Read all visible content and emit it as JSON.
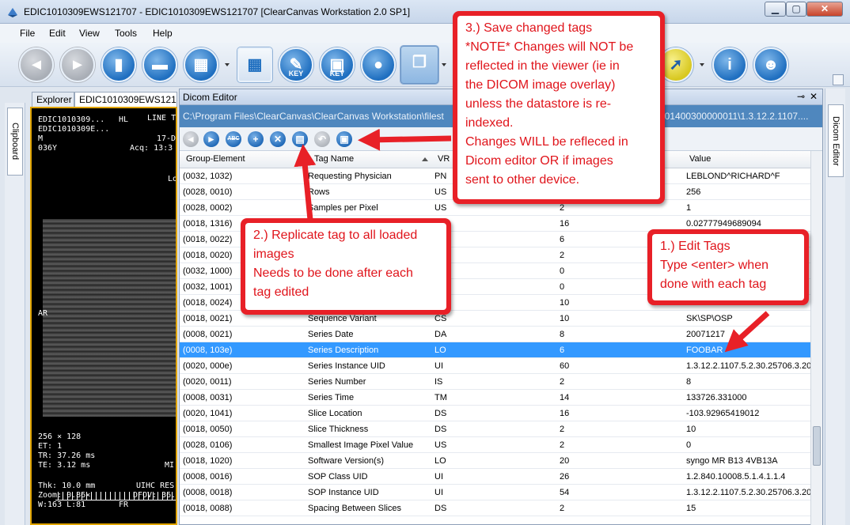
{
  "window": {
    "title": "EDIC1010309EWS121707 - EDIC1010309EWS121707 [ClearCanvas Workstation 2.0 SP1]",
    "min": "▁",
    "max": "▢",
    "close": "✕"
  },
  "menu": [
    "File",
    "Edit",
    "View",
    "Tools",
    "Help"
  ],
  "toolbar": {
    "key_label_1": "KEY",
    "key_label_2": "KEY"
  },
  "clipboard_tab": "Clipboard",
  "tabs": {
    "explorer": "Explorer",
    "study": "EDIC1010309EWS121"
  },
  "viewer": {
    "top_left_1": "EDIC1010309...",
    "top_left_2": "EDIC1010309E...",
    "top_left_3": "M",
    "top_left_4": "036Y",
    "top_mid": "HL",
    "top_right_1": "LINE TA",
    "top_right_2": "17-D",
    "top_right_3": "Acq: 13:3",
    "side_lo": "Lo",
    "orient": "AR",
    "bl_1": "256 × 128",
    "bl_2": "ET: 1",
    "bl_3": "TR: 37.26 ms",
    "bl_4": "TE: 3.12 ms",
    "br_mi": "MI",
    "bl_5": "Thk: 10.0 mm",
    "bl_6": "Zoom: 0.86×",
    "bl_7": "W:163 L:81",
    "br_1": "UIHC RES",
    "br_2": "DFOV: 36.",
    "br_3": "FR"
  },
  "editor": {
    "title": "Dicom Editor",
    "pin": "⊸",
    "close": "✕",
    "path_left": "C:\\Program  Files\\ClearCanvas\\ClearCanvas  Workstation\\filest",
    "path_right": "501400300000011\\1.3.12.2.1107....",
    "icons": {
      "back": "◄",
      "forward": "►",
      "abc": "ABC",
      "add": "+",
      "delete": "✕",
      "replicate": "▤",
      "undo": "↶",
      "save": "▣"
    },
    "columns": {
      "group_element": "Group-Element",
      "tag_name": "Tag Name",
      "vr": "VR",
      "value": "Value"
    },
    "rows": [
      {
        "ge": "(0032, 1032)",
        "name": "Requesting Physician",
        "vr": "PN",
        "len": "",
        "val": "LEBLOND^RICHARD^F",
        "sel": false
      },
      {
        "ge": "(0028, 0010)",
        "name": "Rows",
        "vr": "US",
        "len": "",
        "val": "256",
        "sel": false
      },
      {
        "ge": "(0028, 0002)",
        "name": "Samples per Pixel",
        "vr": "US",
        "len": "2",
        "val": "1",
        "sel": false
      },
      {
        "ge": "(0018, 1316)",
        "name": "",
        "vr": "",
        "len": "16",
        "val": "0.02777949689094",
        "sel": false
      },
      {
        "ge": "(0018, 0022)",
        "name": "",
        "vr": "",
        "len": "6",
        "val": "",
        "sel": false
      },
      {
        "ge": "(0018, 0020)",
        "name": "",
        "vr": "",
        "len": "2",
        "val": "",
        "sel": false
      },
      {
        "ge": "(0032, 1000)",
        "name": "",
        "vr": "",
        "len": "0",
        "val": "",
        "sel": false
      },
      {
        "ge": "(0032, 1001)",
        "name": "",
        "vr": "",
        "len": "0",
        "val": "",
        "sel": false
      },
      {
        "ge": "(0018, 0024)",
        "name": "",
        "vr": "",
        "len": "10",
        "val": "",
        "sel": false
      },
      {
        "ge": "(0018, 0021)",
        "name": "Sequence Variant",
        "vr": "CS",
        "len": "10",
        "val": "SK\\SP\\OSP",
        "sel": false
      },
      {
        "ge": "(0008, 0021)",
        "name": "Series Date",
        "vr": "DA",
        "len": "8",
        "val": "20071217",
        "sel": false
      },
      {
        "ge": "(0008, 103e)",
        "name": "Series Description",
        "vr": "LO",
        "len": "6",
        "val": "FOOBAR",
        "sel": true
      },
      {
        "ge": "(0020, 000e)",
        "name": "Series Instance UID",
        "vr": "UI",
        "len": "60",
        "val": "1.3.12.2.1107.5.2.30.25706.3.20",
        "sel": false
      },
      {
        "ge": "(0020, 0011)",
        "name": "Series Number",
        "vr": "IS",
        "len": "2",
        "val": "8",
        "sel": false
      },
      {
        "ge": "(0008, 0031)",
        "name": "Series Time",
        "vr": "TM",
        "len": "14",
        "val": "133726.331000",
        "sel": false
      },
      {
        "ge": "(0020, 1041)",
        "name": "Slice Location",
        "vr": "DS",
        "len": "16",
        "val": "-103.92965419012",
        "sel": false
      },
      {
        "ge": "(0018, 0050)",
        "name": "Slice Thickness",
        "vr": "DS",
        "len": "2",
        "val": "10",
        "sel": false
      },
      {
        "ge": "(0028, 0106)",
        "name": "Smallest Image Pixel Value",
        "vr": "US",
        "len": "2",
        "val": "0",
        "sel": false
      },
      {
        "ge": "(0018, 1020)",
        "name": "Software Version(s)",
        "vr": "LO",
        "len": "20",
        "val": "syngo MR B13 4VB13A",
        "sel": false
      },
      {
        "ge": "(0008, 0016)",
        "name": "SOP Class UID",
        "vr": "UI",
        "len": "26",
        "val": "1.2.840.10008.5.1.4.1.1.4",
        "sel": false
      },
      {
        "ge": "(0008, 0018)",
        "name": "SOP Instance UID",
        "vr": "UI",
        "len": "54",
        "val": "1.3.12.2.1107.5.2.30.25706.3.20",
        "sel": false
      },
      {
        "ge": "(0018, 0088)",
        "name": "Spacing Between Slices",
        "vr": "DS",
        "len": "2",
        "val": "15",
        "sel": false
      }
    ]
  },
  "right_tab": "Dicom Editor",
  "callouts": {
    "c3": [
      "3.)  Save changed tags",
      "*NOTE*  Changes will NOT be",
      "reflected in the viewer (ie in",
      "the DICOM image overlay)",
      "unless the datastore is re-",
      "indexed.",
      "Changes WILL be refleced in",
      "Dicom editor OR if images",
      "sent to other device."
    ],
    "c2": [
      "2.)  Replicate tag to all loaded",
      "images",
      "Needs to be done after each",
      "tag edited"
    ],
    "c1": [
      "1.)  Edit Tags",
      "Type <enter> when",
      "done with each tag"
    ]
  },
  "colors": {
    "callout_red": "#e82027",
    "selection_blue": "#3399ff",
    "path_bar": "#4f87be"
  }
}
